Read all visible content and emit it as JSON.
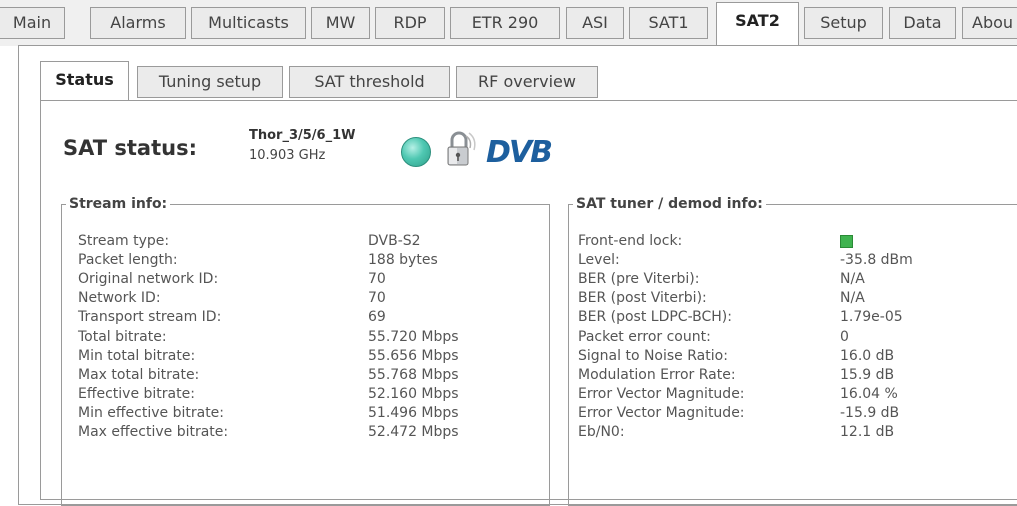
{
  "main_tabs": [
    "Main",
    "Alarms",
    "Multicasts",
    "MW",
    "RDP",
    "ETR 290",
    "ASI",
    "SAT1",
    "SAT2",
    "Setup",
    "Data",
    "Abou"
  ],
  "active_main_tab": "SAT2",
  "sub_tabs": [
    "Status",
    "Tuning setup",
    "SAT threshold",
    "RF overview"
  ],
  "active_sub_tab": "Status",
  "sat_status": {
    "title": "SAT status:",
    "satellite_name": "Thor_3/5/6_1W",
    "frequency": "10.903 GHz",
    "logo_text": "DVB",
    "status_color": "#4fc8b2"
  },
  "stream_info": {
    "legend": "Stream info:",
    "rows": [
      {
        "label": "Stream type:",
        "value": "DVB-S2"
      },
      {
        "label": "Packet length:",
        "value": "188 bytes"
      },
      {
        "label": "Original network ID:",
        "value": "70"
      },
      {
        "label": "Network ID:",
        "value": "70"
      },
      {
        "label": "Transport stream ID:",
        "value": "69"
      },
      {
        "label": "Total bitrate:",
        "value": "55.720 Mbps"
      },
      {
        "label": "Min total bitrate:",
        "value": "55.656 Mbps"
      },
      {
        "label": "Max total bitrate:",
        "value": "55.768 Mbps"
      },
      {
        "label": "Effective bitrate:",
        "value": "52.160 Mbps"
      },
      {
        "label": "Min effective bitrate:",
        "value": "51.496 Mbps"
      },
      {
        "label": "Max effective bitrate:",
        "value": "52.472 Mbps"
      }
    ]
  },
  "tuner_info": {
    "legend": "SAT tuner / demod info:",
    "rows": [
      {
        "label": "Front-end lock:",
        "value": "",
        "indicator": "green-lock"
      },
      {
        "label": "Level:",
        "value": "-35.8 dBm"
      },
      {
        "label": "BER (pre Viterbi):",
        "value": "N/A"
      },
      {
        "label": "BER (post Viterbi):",
        "value": "N/A"
      },
      {
        "label": "BER (post LDPC-BCH):",
        "value": "1.79e-05"
      },
      {
        "label": "Packet error count:",
        "value": "0"
      },
      {
        "label": "Signal to Noise Ratio:",
        "value": "16.0 dB"
      },
      {
        "label": "Modulation Error Rate:",
        "value": "15.9 dB"
      },
      {
        "label": "Error Vector Magnitude:",
        "value": "16.04 %"
      },
      {
        "label": "Error Vector Magnitude:",
        "value": "-15.9 dB"
      },
      {
        "label": "Eb/N0:",
        "value": "12.1 dB"
      }
    ]
  },
  "colors": {
    "lock_green": "#3fb34f",
    "logo_blue": "#1d5f9e"
  }
}
